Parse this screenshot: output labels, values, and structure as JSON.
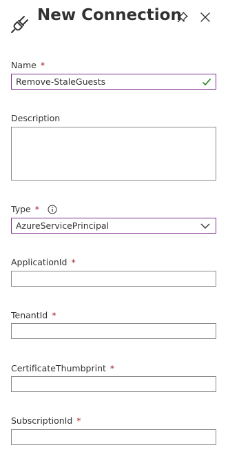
{
  "header": {
    "title": "New Connection",
    "icons": {
      "plug": "plug-icon",
      "pin": "pin-icon",
      "close": "close-icon"
    }
  },
  "form": {
    "name": {
      "label": "Name",
      "required": "*",
      "value": "Remove-StaleGuests"
    },
    "description": {
      "label": "Description",
      "value": ""
    },
    "type": {
      "label": "Type",
      "required": "*",
      "value": "AzureServicePrincipal"
    },
    "application_id": {
      "label": "ApplicationId",
      "required": "*",
      "value": ""
    },
    "tenant_id": {
      "label": "TenantId",
      "required": "*",
      "value": ""
    },
    "certificate_thumbprint": {
      "label": "CertificateThumbprint",
      "required": "*",
      "value": ""
    },
    "subscription_id": {
      "label": "SubscriptionId",
      "required": "*",
      "value": ""
    }
  },
  "colors": {
    "required": "#a4262c",
    "focus_border": "#7a2d8c",
    "valid_check": "#107c10"
  }
}
